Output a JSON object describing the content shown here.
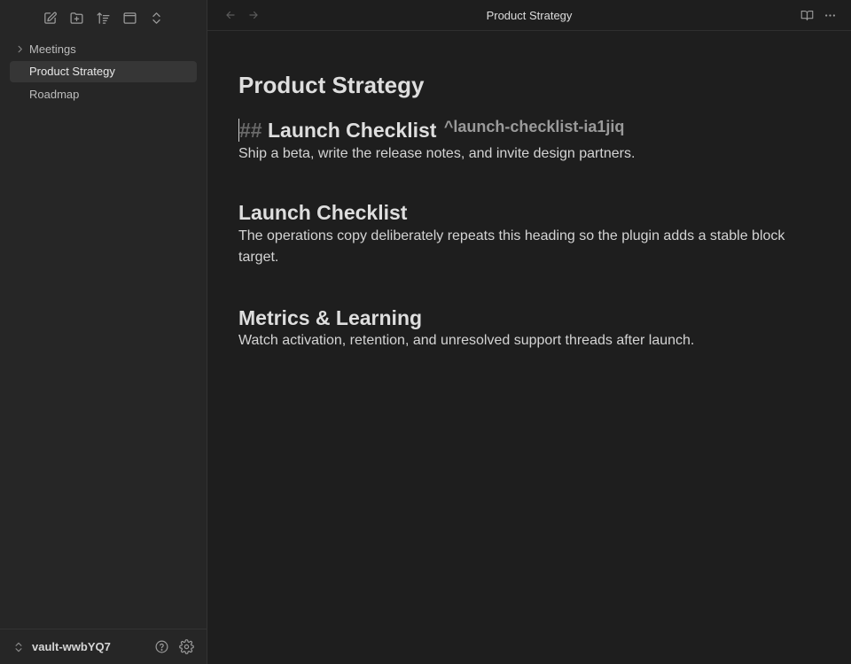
{
  "sidebar": {
    "toolbar": [
      {
        "name": "new-note-icon"
      },
      {
        "name": "new-folder-icon"
      },
      {
        "name": "sort-icon"
      },
      {
        "name": "auto-reveal-icon"
      },
      {
        "name": "expand-collapse-icon"
      }
    ],
    "items": [
      {
        "label": "Meetings",
        "type": "folder",
        "collapsed": true
      },
      {
        "label": "Product Strategy",
        "type": "file",
        "active": true
      },
      {
        "label": "Roadmap",
        "type": "file"
      }
    ],
    "vault_name": "vault-wwbYQ7"
  },
  "titlebar": {
    "title": "Product Strategy"
  },
  "editor": {
    "title": "Product Strategy",
    "sections": [
      {
        "heading_marker": "##",
        "heading": "Launch Checklist",
        "block_id": "^launch-checklist-ia1jiq",
        "body": "Ship a beta, write the release notes, and invite design partners."
      },
      {
        "heading": "Launch Checklist",
        "body": "The operations copy deliberately repeats this heading so the plugin adds a stable block target."
      },
      {
        "heading": "Metrics & Learning",
        "body": "Watch activation, retention, and unresolved support threads after launch."
      }
    ]
  },
  "colors": {
    "background": "#1e1e1e",
    "sidebar": "#262626",
    "active_item": "#363636",
    "text": "#dadada",
    "muted": "#9a9a9a"
  }
}
